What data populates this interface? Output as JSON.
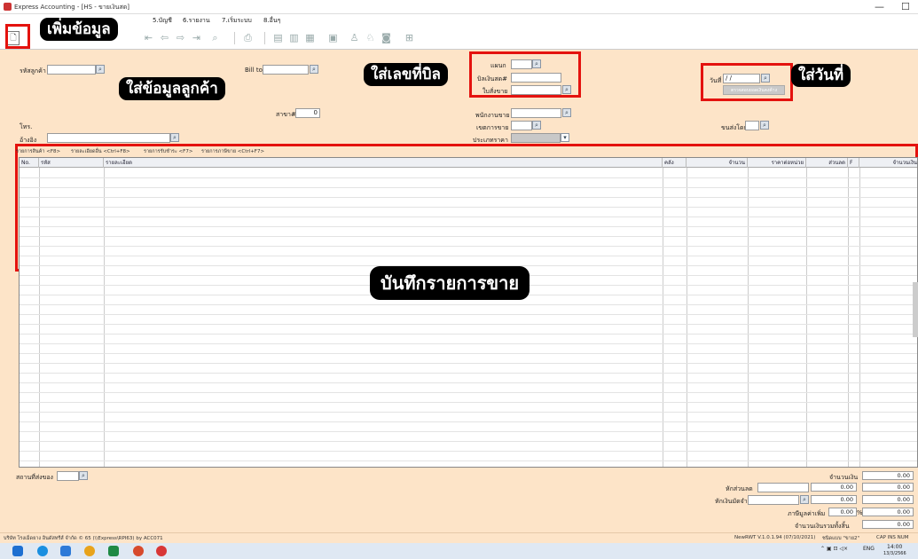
{
  "window": {
    "title": "Express Accounting - [HS - ขายเงินสด]",
    "minimize": "—",
    "maximize": "☐"
  },
  "menu": [
    "5.บัญชี",
    "6.รายงาน",
    "7.เริ่มระบบ",
    "8.อื่นๆ"
  ],
  "callouts": {
    "add_data": "เพิ่มข้อมูล",
    "customer_data": "ใส่ข้อมูลลูกค้า",
    "bill_number": "ใส่เลขที่บิล",
    "date": "ใส่วันที่",
    "sales_record": "บันทึกรายการขาย"
  },
  "header": {
    "customer_code_label": "รหัสลูกค้า",
    "customer_code_value": "",
    "bill_to_label": "Bill to",
    "branch_label": "สาขา#",
    "branch_value": "0",
    "phone_label": "โทร.",
    "reference_label": "อ้างอิง",
    "department_label": "แผนก",
    "tax_invoice_label": "บิลเงินสด#",
    "quote_label": "ใบสั่งขาย",
    "salesperson_label": "พนักงานขาย",
    "payment_term_label": "เขตการขาย",
    "price_type_label": "ประเภทราคา",
    "date_label": "วันที่",
    "date_value": "/ /",
    "date_button": "ตรวจสอบยอดเงินคงค้าง",
    "ship_via_label": "ขนส่งโดย"
  },
  "tabs": [
    "รายการสินค้า <F8>",
    "รายละเอียดอื่น <Ctrl+F8>",
    "รายการรับชำระ <F7>",
    "รายการภาษีขาย <Ctrl+F7>"
  ],
  "grid": {
    "columns": [
      "No.",
      "รหัส",
      "รายละเอียด",
      "คลัง",
      "จำนวน",
      "ราคาต่อหน่วย",
      "ส่วนลด",
      "F",
      "จำนวนเงิน"
    ]
  },
  "footer": {
    "ship_to_label": "สถานที่ส่งของ",
    "amount_label": "จำนวนเงิน",
    "amount_value": "0.00",
    "discount_label": "หักส่วนลด",
    "discount_value": "0.00",
    "deposit_label": "หักเงินมัดจำ",
    "deposit_value": "0.00",
    "vat_label": "ภาษีมูลค่าเพิ่ม",
    "vat_rate": "0.00",
    "vat_percent": "%",
    "vat_value": "0.00",
    "net_label": "จำนวนเงินรวมทั้งสิ้น",
    "net_value": "0.00"
  },
  "status": {
    "company": "บริษัท โรงเม็ดยาง อินดัสทรีส์ จำกัด © 65 (\\\\Express\\RPI63) by ACC071",
    "version": "NewRWT V.1.0.1.94 (07/10/2021)",
    "user": "ชนิดแบบ \"ขาย2\"",
    "keys": "CAP  INS  NUM"
  },
  "taskbar": {
    "lang": "ENG",
    "time": "14:00",
    "date": "13/3/2566"
  }
}
